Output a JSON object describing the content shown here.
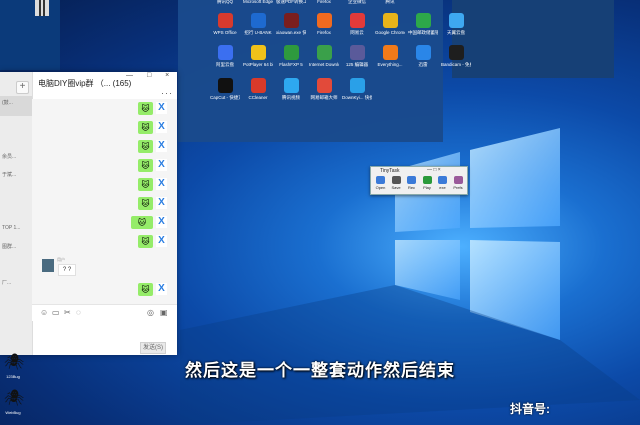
{
  "chat": {
    "title": "电脑DIY圈vip群 （... (165)",
    "minmax": "— □ ×",
    "dots": "···",
    "add_symbol": "+",
    "contacts": [
      {
        "text": "(鼓...",
        "time": ""
      },
      {
        "text": "",
        "time": ""
      },
      {
        "text": "",
        "time": ""
      },
      {
        "text": "余员...",
        "time": ""
      },
      {
        "text": "于斌...",
        "time": ""
      },
      {
        "text": "",
        "time": ""
      },
      {
        "text": "",
        "time": ""
      },
      {
        "text": "TOP 1...",
        "time": ""
      },
      {
        "text": "图群...",
        "time": ""
      },
      {
        "text": "",
        "time": ""
      },
      {
        "text": "厂...",
        "time": ""
      },
      {
        "text": "",
        "time": ""
      },
      {
        "text": "",
        "time": ""
      },
      {
        "text": "",
        "time": ""
      }
    ],
    "messages_count": 10,
    "bubble_glyph": "🐱",
    "contact_avatar_glyph": "X",
    "incoming_text": "? ?",
    "incoming_name": "用户",
    "send_label": "发送(S)"
  },
  "desktop": {
    "row1": [
      {
        "label": "腾讯QQ",
        "color": "#3a8ef0"
      },
      {
        "label": "Microsoft Edge",
        "color": "#1e9be8"
      },
      {
        "label": "极速PDF转换工具",
        "color": "#d84040"
      },
      {
        "label": "Firefox",
        "color": "#f06a20"
      },
      {
        "label": "企业微信",
        "color": "#2e7bd6"
      },
      {
        "label": "腾讯",
        "color": "#3aa0f0"
      },
      {
        "label": "",
        "color": "#3aa0f0"
      },
      {
        "label": "",
        "color": "#3aa0f0"
      }
    ],
    "row2": [
      {
        "label": "WPS Office",
        "color": "#d63a2e"
      },
      {
        "label": "招行 U-BANK",
        "color": "#1e6ad0"
      },
      {
        "label": "xiaowan.exe 快捷方式",
        "color": "#7a1e1e"
      },
      {
        "label": "Firefox",
        "color": "#f06a20"
      },
      {
        "label": "网易云",
        "color": "#e23a3a"
      },
      {
        "label": "Google Chrome",
        "color": "#e8b41a"
      },
      {
        "label": "中国邮政储蓄银行企...",
        "color": "#2da84a"
      },
      {
        "label": "天翼云盘",
        "color": "#3ea8f0"
      }
    ],
    "row3": [
      {
        "label": "阿里云盘",
        "color": "#3b6ff0"
      },
      {
        "label": "PotPlayer 64 bit",
        "color": "#f0c21a"
      },
      {
        "label": "FlashFXP 5",
        "color": "#2e9a3e"
      },
      {
        "label": "Internet Downlo...",
        "color": "#3aa04a"
      },
      {
        "label": "125 编辑器",
        "color": "#5a5a9a"
      },
      {
        "label": "Everything...",
        "color": "#f07a1a"
      },
      {
        "label": "迅雷",
        "color": "#2a86e8"
      },
      {
        "label": "Bandicam - 免费录屏...",
        "color": "#1e1e1e"
      }
    ],
    "row4": [
      {
        "label": "CapCut - 快捷方式",
        "color": "#111111"
      },
      {
        "label": "CCleaner",
        "color": "#d83a2a"
      },
      {
        "label": "腾讯视频",
        "color": "#2ea8f0"
      },
      {
        "label": "网易邮箱大师",
        "color": "#e24a3a"
      },
      {
        "label": "DownKyi... 快捷方式",
        "color": "#2aa0e8"
      }
    ]
  },
  "tinytask": {
    "title": "TinyTask",
    "controls": "— □ ×",
    "buttons": [
      {
        "label": "Open",
        "color": "#3a7ad8"
      },
      {
        "label": "Save",
        "color": "#555555"
      },
      {
        "label": "Rec",
        "color": "#3a7ad8"
      },
      {
        "label": "Play",
        "color": "#2a9a3a"
      },
      {
        "label": "exe",
        "color": "#3a7ad8"
      },
      {
        "label": "Prefs",
        "color": "#9a5a9a"
      }
    ]
  },
  "left_icons": [
    {
      "label": "123Bug"
    },
    {
      "label": "WebBug"
    }
  ],
  "subtitle": "然后这是一个一整套动作然后结束",
  "watermark": "抖音号:"
}
